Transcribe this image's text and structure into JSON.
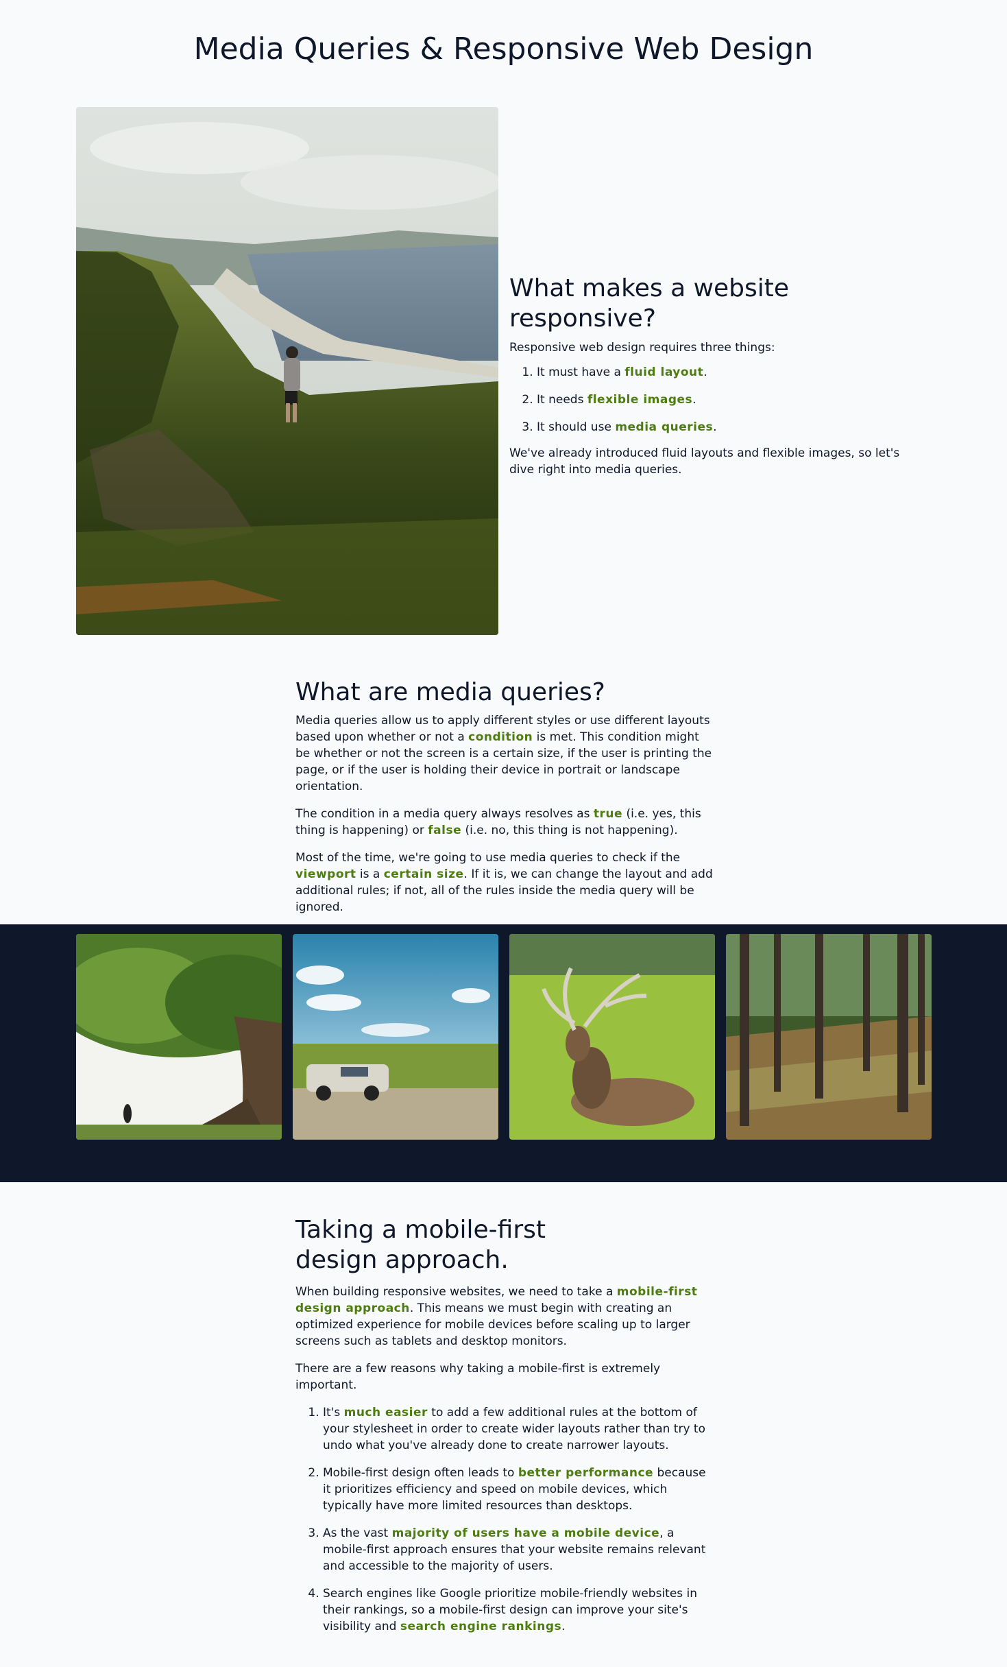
{
  "page": {
    "title": "Media Queries & Responsive Web Design"
  },
  "responsive": {
    "heading": "What makes a website responsive?",
    "intro": "Responsive web design requires three things:",
    "items": [
      {
        "before": "It must have a ",
        "highlight": "fluid layout",
        "after": "."
      },
      {
        "before": "It needs ",
        "highlight": "flexible images",
        "after": "."
      },
      {
        "before": "It should use ",
        "highlight": "media queries",
        "after": "."
      }
    ],
    "outro": "We've already introduced fluid layouts and flexible images, so let's dive right into media queries."
  },
  "media_queries": {
    "heading": "What are media queries?",
    "p1": {
      "a": "Media queries allow us to apply different styles or use different layouts based upon whether or not a ",
      "b": "condition",
      "c": " is met. This condition might be whether or not the screen is a certain size, if the user is printing the page, or if the user is holding their device in portrait or landscape orientation."
    },
    "p2": {
      "a": "The condition in a media query always resolves as ",
      "b": "true",
      "c": " (i.e. yes, this thing is happening) or ",
      "d": "false",
      "e": " (i.e. no, this thing is not happening)."
    },
    "p3": {
      "a": "Most of the time, we're going to use media queries to check if the ",
      "b": "viewport",
      "c": " is a ",
      "d": "certain size",
      "e": ". If it is, we can change the layout and add additional rules; if not, all of the rules inside the media query will be ignored."
    }
  },
  "mobile_first": {
    "heading": "Taking a mobile-first design approach.",
    "p1": {
      "a": "When building responsive websites, we need to take a ",
      "b": "mobile-first design approach",
      "c": ". This means we must begin with creating an optimized experience for mobile devices before scaling up to larger screens such as tablets and desktop monitors."
    },
    "p2": "There are a few reasons why taking a mobile-first is extremely important.",
    "items": [
      {
        "before": "It's ",
        "highlight": "much easier",
        "after": " to add a few additional rules at the bottom of your stylesheet in order to create wider layouts rather than try to undo what you've already done to create narrower layouts."
      },
      {
        "before": "Mobile-first design often leads to ",
        "highlight": "better performance",
        "after": " because it prioritizes efficiency and speed on mobile devices, which typically have more limited resources than desktops."
      },
      {
        "before": "As the vast ",
        "highlight": "majority of users have a mobile device",
        "after": ", a mobile-first approach ensures that your website remains relevant and accessible to the majority of users."
      },
      {
        "before": "Search engines like Google prioritize mobile-friendly websites in their rankings, so a mobile-first design can improve your site's visibility and ",
        "highlight": "search engine rankings",
        "after": "."
      }
    ]
  },
  "colors": {
    "background": "#f8fafc",
    "text": "#0f172a",
    "highlight": "#4d7c0f",
    "gallery_band": "#0f172a"
  }
}
